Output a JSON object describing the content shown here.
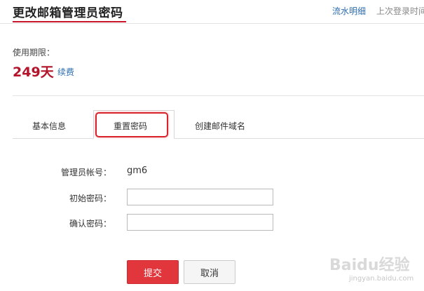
{
  "header": {
    "title": "更改邮箱管理员密码",
    "flow_link": "流水明细",
    "last_login": "上次登录时间"
  },
  "usage": {
    "label": "使用期限：",
    "value": "249天",
    "renew_link": "续费"
  },
  "tabs": [
    {
      "label": "基本信息",
      "active": false
    },
    {
      "label": "重置密码",
      "active": true
    },
    {
      "label": "创建邮件域名",
      "active": false
    }
  ],
  "form": {
    "account_label": "管理员帐号：",
    "account_value": "gm6",
    "initial_password_label": "初始密码：",
    "initial_password_value": "",
    "confirm_password_label": "确认密码：",
    "confirm_password_value": ""
  },
  "buttons": {
    "submit": "提交",
    "cancel": "取消"
  },
  "colors": {
    "accent_red": "#c8162b",
    "link_blue": "#2b6cb0",
    "submit_red": "#e0363c",
    "highlight_red": "#d8232a"
  },
  "watermark": {
    "logo": "Baidu经验",
    "url": "jingyan.baidu.com"
  }
}
